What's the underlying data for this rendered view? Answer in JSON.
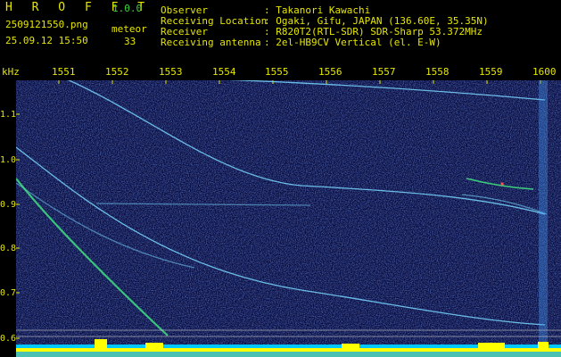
{
  "app": {
    "name": "H R O F F T",
    "version": "1.0.0"
  },
  "file": {
    "name": "2509121550.png",
    "datetime": "25.09.12 15:50"
  },
  "meteor": {
    "label": "meteor",
    "count": "33"
  },
  "info": [
    {
      "label": "Observer",
      "value": ": Takanori Kawachi"
    },
    {
      "label": "Receiving Location",
      "value": ": Ogaki, Gifu, JAPAN (136.60E, 35.35N)"
    },
    {
      "label": "Receiver",
      "value": ": R820T2(RTL-SDR) SDR-Sharp 53.372MHz"
    },
    {
      "label": "Receiving antenna",
      "value": ": 2el-HB9CV Vertical (el. E-W)"
    }
  ],
  "axis": {
    "unit": "kHz",
    "x_ticks": [
      "1551",
      "1552",
      "1553",
      "1554",
      "1555",
      "1556",
      "1557",
      "1558",
      "1559",
      "1600"
    ],
    "y_ticks": [
      "1.1",
      "1.0",
      "0.9",
      "0.8",
      "0.7",
      "0.6"
    ]
  },
  "colors": {
    "background": "#000000",
    "plot_background": "#060a3a",
    "label_yellow": "#e6e600",
    "trace_cyan": "#78d8ff",
    "meteor_green": "#40e080",
    "baseline_yellow": "#ffff00",
    "baseline_cyan": "#00c8ff"
  }
}
